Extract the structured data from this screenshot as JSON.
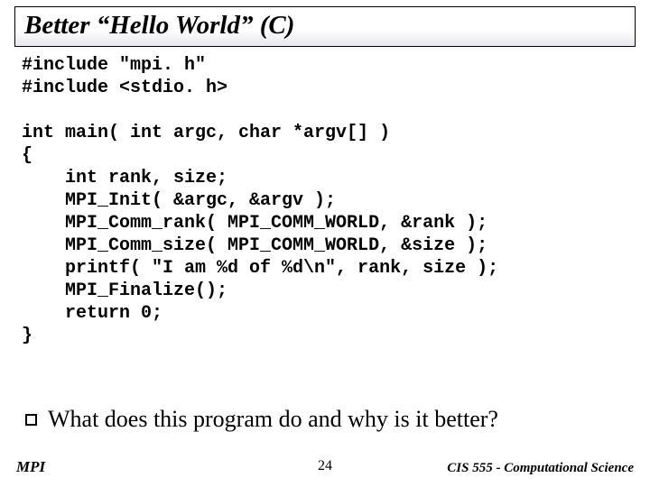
{
  "title": "Better “Hello World” (C)",
  "code": "#include \"mpi. h\"\n#include <stdio. h>\n\nint main( int argc, char *argv[] )\n{\n    int rank, size;\n    MPI_Init( &argc, &argv );\n    MPI_Comm_rank( MPI_COMM_WORLD, &rank );\n    MPI_Comm_size( MPI_COMM_WORLD, &size );\n    printf( \"I am %d of %d\\n\", rank, size );\n    MPI_Finalize();\n    return 0;\n}",
  "question": "What does this program do and why is it better?",
  "footer": {
    "left": "MPI",
    "center": "24",
    "right": "CIS 555 - Computational Science"
  }
}
